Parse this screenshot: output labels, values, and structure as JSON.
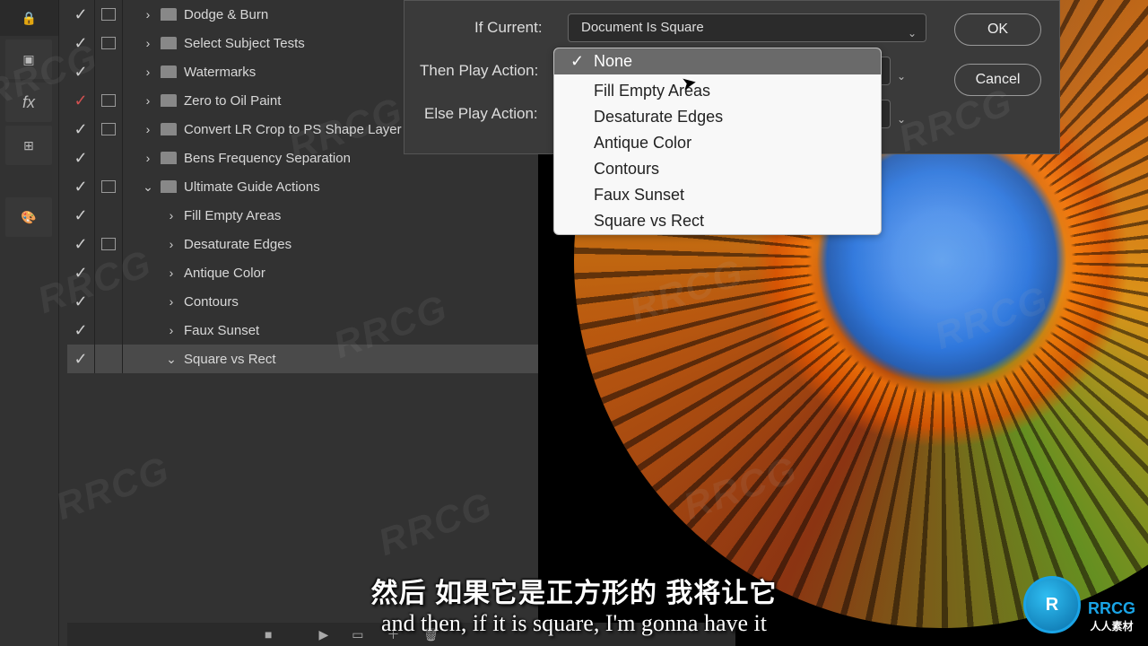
{
  "dialog": {
    "if_current_label": "If Current:",
    "if_current_value": "Document Is Square",
    "then_label": "Then Play Action:",
    "else_label": "Else Play Action:",
    "ok": "OK",
    "cancel": "Cancel"
  },
  "dropdown": {
    "selected": "None",
    "items": [
      "None",
      "Fill Empty Areas",
      "Desaturate Edges",
      "Antique Color",
      "Contours",
      "Faux Sunset",
      "Square vs Rect"
    ]
  },
  "actions": [
    {
      "check": true,
      "modal": true,
      "expand": ">",
      "folder": true,
      "label": "Dodge & Burn",
      "indent": 1
    },
    {
      "check": true,
      "modal": true,
      "expand": ">",
      "folder": true,
      "label": "Select Subject Tests",
      "indent": 1
    },
    {
      "check": true,
      "modal": false,
      "expand": ">",
      "folder": true,
      "label": "Watermarks",
      "indent": 1
    },
    {
      "check": true,
      "check_red": true,
      "modal": true,
      "expand": ">",
      "folder": true,
      "label": "Zero to Oil Paint",
      "indent": 1
    },
    {
      "check": true,
      "modal": true,
      "expand": ">",
      "folder": true,
      "label": "Convert LR Crop to PS Shape Layer",
      "indent": 1
    },
    {
      "check": true,
      "modal": false,
      "expand": ">",
      "folder": true,
      "label": "Bens Frequency Separation",
      "indent": 1
    },
    {
      "check": true,
      "modal": true,
      "expand": "v",
      "folder": true,
      "label": "Ultimate Guide Actions",
      "indent": 1
    },
    {
      "check": true,
      "modal": false,
      "expand": ">",
      "folder": false,
      "label": "Fill Empty Areas",
      "indent": 2
    },
    {
      "check": true,
      "modal": true,
      "expand": ">",
      "folder": false,
      "label": "Desaturate Edges",
      "indent": 2
    },
    {
      "check": true,
      "modal": false,
      "expand": ">",
      "folder": false,
      "label": "Antique Color",
      "indent": 2
    },
    {
      "check": true,
      "modal": false,
      "expand": ">",
      "folder": false,
      "label": "Contours",
      "indent": 2
    },
    {
      "check": true,
      "modal": false,
      "expand": ">",
      "folder": false,
      "label": "Faux Sunset",
      "indent": 2
    },
    {
      "check": true,
      "modal": false,
      "expand": "v",
      "folder": false,
      "label": "Square vs Rect",
      "indent": 2,
      "selected": true
    }
  ],
  "subs": {
    "cn": "然后 如果它是正方形的 我将让它",
    "en": "and then, if it is square, I'm gonna have it"
  },
  "logo": {
    "badge": "R",
    "line1": "RRCG",
    "line2": "人人素材"
  },
  "watermark_text": "RRCG"
}
